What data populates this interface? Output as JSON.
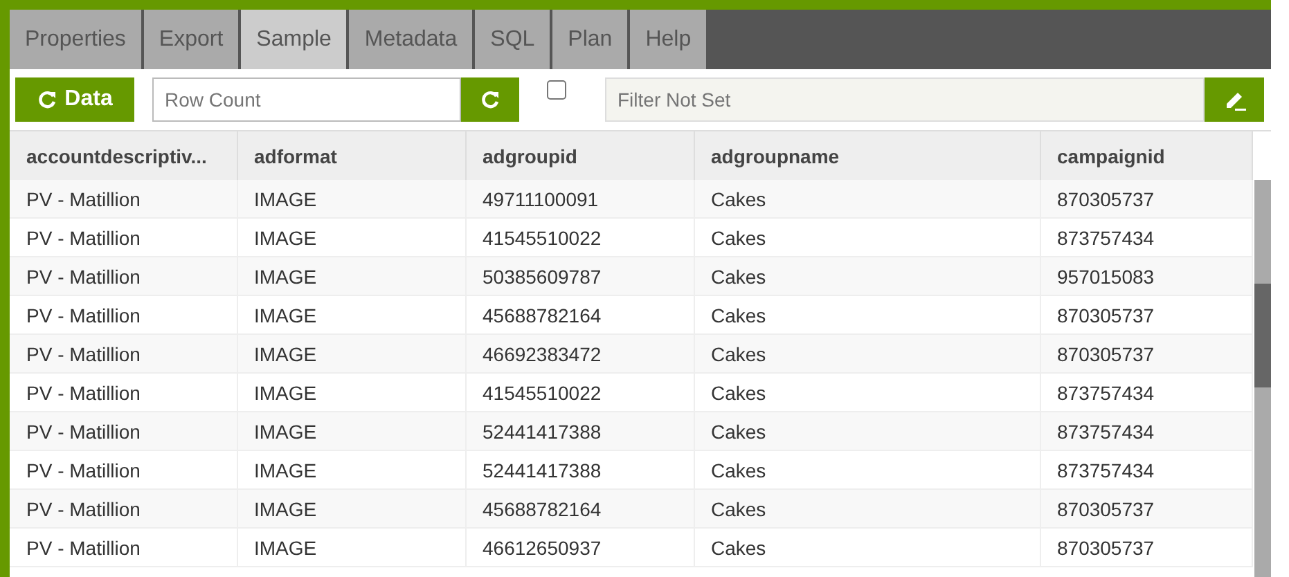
{
  "tabs": [
    {
      "label": "Properties",
      "selected": false
    },
    {
      "label": "Export",
      "selected": false
    },
    {
      "label": "Sample",
      "selected": true
    },
    {
      "label": "Metadata",
      "selected": false
    },
    {
      "label": "SQL",
      "selected": false
    },
    {
      "label": "Plan",
      "selected": false
    },
    {
      "label": "Help",
      "selected": false
    }
  ],
  "toolbar": {
    "data_button": "Data",
    "row_count": {
      "placeholder": "Row Count"
    },
    "checkbox": {
      "checked": false
    },
    "filter": {
      "placeholder": "Filter Not Set"
    }
  },
  "table": {
    "columns": [
      "accountdescriptiv...",
      "adformat",
      "adgroupid",
      "adgroupname",
      "campaignid"
    ],
    "rows": [
      [
        "PV - Matillion",
        "IMAGE",
        "49711100091",
        "Cakes",
        "870305737"
      ],
      [
        "PV - Matillion",
        "IMAGE",
        "41545510022",
        "Cakes",
        "873757434"
      ],
      [
        "PV - Matillion",
        "IMAGE",
        "50385609787",
        "Cakes",
        "957015083"
      ],
      [
        "PV - Matillion",
        "IMAGE",
        "45688782164",
        "Cakes",
        "870305737"
      ],
      [
        "PV - Matillion",
        "IMAGE",
        "46692383472",
        "Cakes",
        "870305737"
      ],
      [
        "PV - Matillion",
        "IMAGE",
        "41545510022",
        "Cakes",
        "873757434"
      ],
      [
        "PV - Matillion",
        "IMAGE",
        "52441417388",
        "Cakes",
        "873757434"
      ],
      [
        "PV - Matillion",
        "IMAGE",
        "52441417388",
        "Cakes",
        "873757434"
      ],
      [
        "PV - Matillion",
        "IMAGE",
        "45688782164",
        "Cakes",
        "870305737"
      ],
      [
        "PV - Matillion",
        "IMAGE",
        "46612650937",
        "Cakes",
        "870305737"
      ]
    ]
  }
}
